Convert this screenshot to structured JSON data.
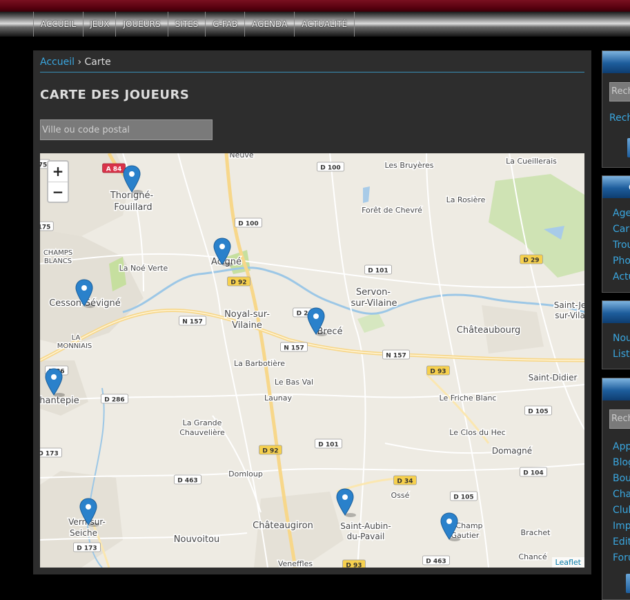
{
  "nav": {
    "items": [
      "ACCUEIL",
      "JEUX",
      "JOUEURS",
      "SITES",
      "G-FAB",
      "AGENDA",
      "ACTUALITÉ"
    ]
  },
  "breadcrumb": {
    "home": "Accueil",
    "separator": "›",
    "current": "Carte"
  },
  "page": {
    "title": "CARTE DES JOUEURS"
  },
  "search": {
    "placeholder": "Ville ou code postal",
    "value": ""
  },
  "map": {
    "zoom_in": "+",
    "zoom_out": "−",
    "attribution": "Leaflet",
    "places": [
      "Thorigné-",
      "Fouillard",
      "Acigné",
      "Cesson-Sévigné",
      "La Noé Verte",
      "Noyal-sur-",
      "Vilaine",
      "Brecé",
      "Servon-",
      "sur-Vilaine",
      "Châteaubourg",
      "Saint-Je",
      "sur-Vila",
      "Saint-Didier",
      "La Barbotière",
      "Le Bas Val",
      "Launay",
      "Le Friche Blanc",
      "Le Clos du Hec",
      "Domagné",
      "La Grande",
      "Chauvelière",
      "Domloup",
      "Ossé",
      "Châteaugiron",
      "Saint-Aubin-",
      "du-Pavail",
      "Champ",
      "Gautier",
      "Brachet",
      "Chancé",
      "Vern-sur-",
      "Seiche",
      "Nouvoitou",
      "Veneffles",
      "Les Bruyères",
      "La Cueillerais",
      "La Rosière",
      "Forêt de Chevré",
      "Neuvé",
      "CHAMPS",
      "BLANCS",
      "LA",
      "MONNIAIS",
      "hantepie"
    ],
    "roads": [
      "A 84",
      "D 100",
      "D 100",
      "D 101",
      "D 29",
      "N 157",
      "N 157",
      "N 157",
      "D 92",
      "D 93",
      "D 286",
      "D 105",
      "D 101",
      "D 92",
      "D 463",
      "D 104",
      "D 34",
      "D 105",
      "D 463",
      "D 173",
      "D 173",
      "D 93",
      "D 2",
      "175",
      "75",
      "D 86"
    ]
  },
  "sidebar": {
    "search_placeholder": "Rech",
    "search_link": "Rech",
    "box2_heading": "C",
    "links_1": [
      "Age",
      "Car",
      "Trou",
      "Pho",
      "Actu"
    ],
    "links_2": [
      "Nou",
      "List"
    ],
    "search2_placeholder": "Rech",
    "links_3": [
      "App",
      "Blog",
      "Bou",
      "Cha",
      "Club",
      "Imp",
      "Edit",
      "Foru"
    ]
  },
  "colors": {
    "accent": "#3aa7e0",
    "marker": "#2a81cb",
    "header": "#55000e"
  }
}
